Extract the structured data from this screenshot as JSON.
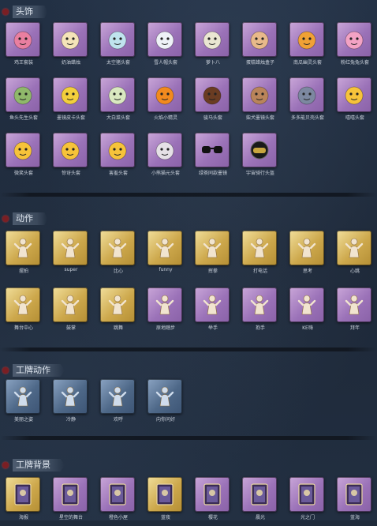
{
  "sections": [
    {
      "title": "头饰",
      "items": [
        {
          "label": "鸡王套装",
          "style": "purple",
          "icon": "pink-chicken-head-icon"
        },
        {
          "label": "奶油蜡烛",
          "style": "purple",
          "icon": "candle-head-icon"
        },
        {
          "label": "太空猪头套",
          "style": "purple",
          "icon": "space-pig-head-icon"
        },
        {
          "label": "雪人帽头套",
          "style": "purple",
          "icon": "snowman-head-icon"
        },
        {
          "label": "萝卜八",
          "style": "purple",
          "icon": "turnip-head-icon"
        },
        {
          "label": "蛋糕蜡烛盒子",
          "style": "purple",
          "icon": "cake-head-icon"
        },
        {
          "label": "南瓜幽灵头套",
          "style": "purple",
          "icon": "pumpkin-head-icon"
        },
        {
          "label": "粉红兔兔头套",
          "style": "purple",
          "icon": "pink-pig-head-icon"
        },
        {
          "label": "鱼头先生头套",
          "style": "purple",
          "icon": "fish-head-icon"
        },
        {
          "label": "墨镜皮卡头套",
          "style": "purple",
          "icon": "pikachu-head-icon"
        },
        {
          "label": "大白菜头套",
          "style": "purple",
          "icon": "cabbage-head-icon"
        },
        {
          "label": "火焰小精灵",
          "style": "purple",
          "icon": "flame-head-icon"
        },
        {
          "label": "骏马头套",
          "style": "purple",
          "icon": "horse-head-icon"
        },
        {
          "label": "柴犬墨镜头套",
          "style": "purple",
          "icon": "dog-head-icon"
        },
        {
          "label": "多多能贝壳头套",
          "style": "purple",
          "icon": "shell-head-icon"
        },
        {
          "label": "嘻嘻头套",
          "style": "purple",
          "icon": "grin-head-icon"
        },
        {
          "label": "微笑头套",
          "style": "purple",
          "icon": "smile-head-icon"
        },
        {
          "label": "惊讶头套",
          "style": "purple",
          "icon": "surprised-head-icon"
        },
        {
          "label": "害羞头套",
          "style": "purple",
          "icon": "shy-head-icon"
        },
        {
          "label": "小熊猫元头套",
          "style": "purple",
          "icon": "panda-head-icon"
        },
        {
          "label": "绿茶同款墨镜",
          "style": "dark",
          "icon": "sunglasses-icon"
        },
        {
          "label": "宇宙骑行头盔",
          "style": "dark",
          "icon": "helmet-icon"
        }
      ]
    },
    {
      "title": "动作",
      "items": [
        {
          "label": "摆拍",
          "style": "gold",
          "icon": "pose-icon"
        },
        {
          "label": "super",
          "style": "gold",
          "icon": "pose-icon"
        },
        {
          "label": "比心",
          "style": "gold",
          "icon": "pose-icon"
        },
        {
          "label": "funny",
          "style": "gold",
          "icon": "pose-icon"
        },
        {
          "label": "挥拳",
          "style": "gold",
          "icon": "pose-icon"
        },
        {
          "label": "打电话",
          "style": "gold",
          "icon": "pose-icon"
        },
        {
          "label": "思考",
          "style": "gold",
          "icon": "pose-icon"
        },
        {
          "label": "心跳",
          "style": "gold",
          "icon": "pose-icon"
        },
        {
          "label": "舞台中心",
          "style": "gold",
          "icon": "pose-icon"
        },
        {
          "label": "鼓掌",
          "style": "gold",
          "icon": "pose-icon"
        },
        {
          "label": "跳舞",
          "style": "gold",
          "icon": "pose-icon"
        },
        {
          "label": "原地踏步",
          "style": "purple",
          "icon": "pose-icon"
        },
        {
          "label": "举手",
          "style": "purple",
          "icon": "pose-icon"
        },
        {
          "label": "抱手",
          "style": "purple",
          "icon": "pose-icon"
        },
        {
          "label": "KE嗨",
          "style": "purple",
          "icon": "pose-icon"
        },
        {
          "label": "拜年",
          "style": "purple",
          "icon": "pose-icon"
        }
      ]
    },
    {
      "title": "工牌动作",
      "items": [
        {
          "label": "美丽之姿",
          "style": "blue",
          "icon": "badge-pose-icon"
        },
        {
          "label": "冷静",
          "style": "blue",
          "icon": "badge-pose-icon"
        },
        {
          "label": "欢呼",
          "style": "blue",
          "icon": "badge-pose-icon"
        },
        {
          "label": "向你问好",
          "style": "blue",
          "icon": "badge-pose-icon"
        }
      ]
    },
    {
      "title": "工牌背景",
      "items": [
        {
          "label": "海报",
          "style": "gold",
          "icon": "card-bg-icon"
        },
        {
          "label": "星空的舞台",
          "style": "purple",
          "icon": "card-bg-icon"
        },
        {
          "label": "橙色小屋",
          "style": "purple",
          "icon": "card-bg-icon"
        },
        {
          "label": "蓝夜",
          "style": "gold",
          "icon": "card-bg-icon"
        },
        {
          "label": "樱花",
          "style": "purple",
          "icon": "card-bg-icon"
        },
        {
          "label": "晨光",
          "style": "purple",
          "icon": "card-bg-icon"
        },
        {
          "label": "光之门",
          "style": "purple",
          "icon": "card-bg-icon"
        },
        {
          "label": "蓝海",
          "style": "purple",
          "icon": "card-bg-icon"
        }
      ]
    }
  ]
}
